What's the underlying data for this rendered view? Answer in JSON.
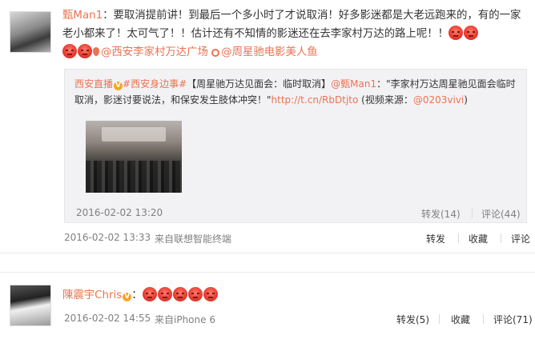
{
  "post1": {
    "author": "甄Man1",
    "text_before": "：要取消提前讲！到最后一个多小时了才说取消！好多影迷都是大老远跑来的，有的一家老小都来了！太可气了！！估计还有不知情的影迷还在去李家村万达的路上呢！！",
    "emoji_icon": "angry-face-icon",
    "location_link": "@西安李家村万达广场",
    "movie_link": "@周星驰电影美人鱼",
    "repost": {
      "author": "西安直播",
      "badge": "V",
      "hashtag": "#西安身边事#",
      "text1": "【周星驰万达见面会：临时取消】",
      "mention": "@甄Man1",
      "text2": "：\"李家村万达周星驰见面会临时取消，影迷讨要说法，和保安发生肢体冲突！\"",
      "url": "http://t.cn/RbDtjto",
      "text3": " (视频来源：",
      "source_mention": "@0203vivi",
      "text4": ")",
      "time": "2016-02-02 13:20",
      "repost_label": "转发(14)",
      "comment_label": "评论(44)"
    },
    "time": "2016-02-02 13:33",
    "source": "来自联想智能终端",
    "actions": {
      "repost": "转发",
      "favorite": "收藏",
      "comment": "评论"
    }
  },
  "post2": {
    "author": "陳震宇Chris",
    "badge": "V",
    "colon": "：",
    "emoji_count": 5,
    "time": "2016-02-02 14:55",
    "source": "来自iPhone 6",
    "actions": {
      "repost": "转发(5)",
      "favorite": "收藏",
      "comment": "评论(71)"
    }
  },
  "colors": {
    "link": "#eb7350",
    "badge": "#f6a623",
    "meta": "#808080"
  }
}
